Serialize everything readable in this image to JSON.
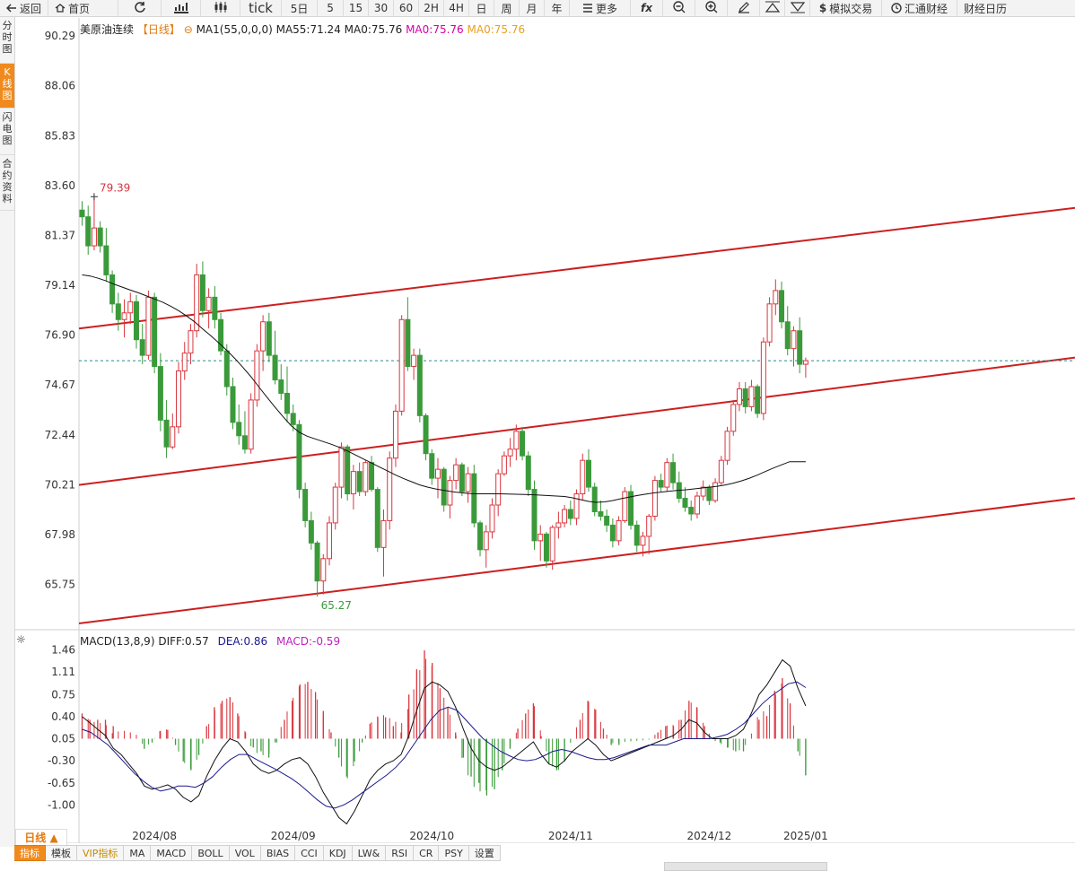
{
  "toolbar": {
    "back": "返回",
    "home": "首页",
    "refresh_icon": "refresh-icon",
    "draw_icon": "line-chart-icon",
    "candle_icon": "candle-icon",
    "tick": "tick",
    "five_day": "5日",
    "periods": [
      "5",
      "15",
      "30",
      "60",
      "2H",
      "4H",
      "日",
      "周",
      "月",
      "年"
    ],
    "more": "更多",
    "fx": "fx",
    "zoom_out_icon": "zoom-out-icon",
    "zoom_in_icon": "zoom-in-icon",
    "pen_icon": "pen-icon",
    "up_icon": "triangle-up-icon",
    "down_icon": "triangle-down-icon",
    "sim_trade": "模拟交易",
    "huitong": "汇通财经",
    "calendar": "财经日历"
  },
  "side_tabs": [
    "分时图",
    "K线图",
    "闪电图",
    "合约资料"
  ],
  "legend": {
    "name": "美原油连续",
    "period": "【日线】",
    "ma1": "MA1(55,0,0,0)",
    "ma55": "MA55:71.24",
    "ma0a": "MA0:75.76",
    "ma0b": "MA0:75.76",
    "ma0c": "MA0:75.76"
  },
  "macd_legend": {
    "name": "MACD(13,8,9)",
    "diff": "DIFF:0.57",
    "dea": "DEA:0.86",
    "macd": "MACD:-0.59"
  },
  "colors": {
    "up": "#d9363e",
    "down": "#3a9a3a",
    "ma": "#111111",
    "trend": "#cc1f1f",
    "dea": "#1a1a8c",
    "current": "#2a8a8a"
  },
  "chart_data": {
    "type": "candlestick",
    "title": "美原油连续",
    "current_price": 75.76,
    "high_label": "79.39",
    "low_label": "65.27",
    "y_ticks": [
      "90.29",
      "88.06",
      "85.83",
      "83.60",
      "81.37",
      "79.14",
      "76.90",
      "74.67",
      "72.44",
      "70.21",
      "67.98",
      "65.75"
    ],
    "y_range": [
      63.8,
      91.1
    ],
    "x_labels": [
      "2024/08",
      "2024/09",
      "2024/10",
      "2024/11",
      "2024/12",
      "2025/01"
    ],
    "ohlc": [
      [
        82.5,
        82.9,
        81.8,
        82.2
      ],
      [
        82.2,
        82.7,
        80.5,
        80.9
      ],
      [
        80.9,
        83.1,
        80.7,
        81.7
      ],
      [
        81.7,
        82.0,
        80.6,
        80.9
      ],
      [
        80.9,
        81.7,
        79.3,
        79.6
      ],
      [
        79.6,
        79.8,
        77.9,
        78.3
      ],
      [
        78.3,
        78.8,
        77.1,
        77.6
      ],
      [
        77.6,
        78.5,
        76.8,
        77.9
      ],
      [
        77.9,
        78.8,
        77.4,
        78.4
      ],
      [
        78.4,
        78.7,
        76.3,
        76.7
      ],
      [
        76.7,
        77.4,
        75.6,
        76.0
      ],
      [
        76.0,
        78.9,
        75.8,
        78.6
      ],
      [
        78.6,
        78.8,
        75.2,
        75.5
      ],
      [
        75.5,
        76.1,
        72.6,
        73.1
      ],
      [
        73.1,
        74.0,
        71.4,
        71.9
      ],
      [
        71.9,
        73.4,
        71.8,
        72.8
      ],
      [
        72.8,
        75.7,
        72.5,
        75.3
      ],
      [
        75.3,
        76.6,
        74.9,
        76.1
      ],
      [
        76.1,
        77.4,
        75.6,
        77.1
      ],
      [
        77.1,
        80.1,
        76.8,
        79.6
      ],
      [
        79.6,
        80.2,
        77.7,
        78.0
      ],
      [
        78.0,
        79.0,
        77.2,
        78.6
      ],
      [
        78.6,
        79.1,
        77.2,
        77.6
      ],
      [
        77.6,
        77.9,
        76.0,
        76.2
      ],
      [
        76.2,
        76.5,
        74.2,
        74.6
      ],
      [
        74.6,
        75.0,
        72.7,
        73.0
      ],
      [
        73.0,
        73.8,
        72.0,
        72.4
      ],
      [
        72.4,
        73.5,
        71.6,
        71.8
      ],
      [
        71.8,
        74.3,
        71.6,
        74.0
      ],
      [
        74.0,
        76.5,
        73.7,
        76.2
      ],
      [
        76.2,
        77.8,
        75.3,
        77.5
      ],
      [
        77.5,
        77.9,
        75.7,
        76.0
      ],
      [
        76.0,
        77.1,
        74.7,
        74.9
      ],
      [
        74.9,
        75.6,
        74.0,
        74.3
      ],
      [
        74.3,
        75.5,
        73.0,
        73.4
      ],
      [
        73.4,
        73.8,
        72.6,
        72.9
      ],
      [
        72.9,
        73.1,
        69.6,
        70.0
      ],
      [
        70.0,
        70.3,
        68.3,
        68.6
      ],
      [
        68.6,
        69.0,
        67.3,
        67.6
      ],
      [
        67.6,
        67.7,
        65.2,
        65.9
      ],
      [
        65.9,
        67.1,
        65.3,
        66.9
      ],
      [
        66.9,
        68.8,
        66.6,
        68.5
      ],
      [
        68.5,
        70.3,
        68.2,
        70.1
      ],
      [
        70.1,
        72.1,
        69.6,
        71.9
      ],
      [
        71.9,
        72.0,
        69.5,
        69.8
      ],
      [
        69.8,
        71.1,
        69.1,
        70.8
      ],
      [
        70.8,
        71.2,
        69.7,
        69.9
      ],
      [
        69.9,
        71.3,
        69.7,
        71.2
      ],
      [
        71.2,
        71.5,
        69.9,
        70.0
      ],
      [
        70.0,
        70.1,
        67.2,
        67.4
      ],
      [
        67.4,
        69.1,
        66.1,
        68.6
      ],
      [
        68.6,
        71.7,
        68.2,
        71.4
      ],
      [
        71.4,
        73.8,
        71.0,
        73.5
      ],
      [
        73.5,
        77.8,
        73.3,
        77.6
      ],
      [
        77.6,
        78.6,
        75.3,
        75.5
      ],
      [
        75.5,
        76.3,
        74.9,
        76.0
      ],
      [
        76.0,
        76.3,
        73.0,
        73.3
      ],
      [
        73.3,
        73.4,
        71.3,
        71.6
      ],
      [
        71.6,
        71.8,
        70.2,
        70.5
      ],
      [
        70.5,
        71.4,
        69.6,
        70.9
      ],
      [
        70.9,
        71.0,
        69.0,
        69.3
      ],
      [
        69.3,
        70.6,
        68.7,
        70.4
      ],
      [
        70.4,
        71.4,
        70.0,
        71.1
      ],
      [
        71.1,
        71.2,
        69.7,
        69.9
      ],
      [
        69.9,
        71.0,
        69.4,
        70.7
      ],
      [
        70.7,
        71.1,
        68.3,
        68.5
      ],
      [
        68.5,
        68.6,
        67.0,
        67.3
      ],
      [
        67.3,
        68.4,
        66.5,
        68.1
      ],
      [
        68.1,
        69.6,
        67.8,
        69.3
      ],
      [
        69.3,
        70.9,
        68.8,
        70.7
      ],
      [
        70.7,
        71.7,
        70.6,
        71.5
      ],
      [
        71.5,
        72.3,
        71.0,
        71.8
      ],
      [
        71.8,
        72.9,
        71.3,
        72.6
      ],
      [
        72.6,
        72.8,
        71.3,
        71.5
      ],
      [
        71.5,
        71.7,
        69.7,
        70.0
      ],
      [
        70.0,
        70.4,
        67.3,
        67.7
      ],
      [
        67.7,
        68.4,
        66.8,
        68.0
      ],
      [
        68.0,
        68.1,
        66.5,
        66.8
      ],
      [
        66.8,
        68.4,
        66.4,
        68.3
      ],
      [
        68.3,
        69.0,
        67.8,
        68.5
      ],
      [
        68.5,
        69.3,
        68.3,
        69.1
      ],
      [
        69.1,
        69.5,
        68.4,
        68.7
      ],
      [
        68.7,
        70.0,
        68.4,
        69.8
      ],
      [
        69.8,
        71.6,
        69.5,
        71.3
      ],
      [
        71.3,
        71.8,
        69.9,
        70.1
      ],
      [
        70.1,
        70.3,
        68.8,
        69.0
      ],
      [
        69.0,
        69.5,
        68.6,
        68.8
      ],
      [
        68.8,
        69.1,
        68.1,
        68.4
      ],
      [
        68.4,
        68.7,
        67.4,
        67.7
      ],
      [
        67.7,
        68.8,
        67.5,
        68.6
      ],
      [
        68.6,
        70.1,
        68.5,
        69.9
      ],
      [
        69.9,
        70.2,
        68.2,
        68.4
      ],
      [
        68.4,
        68.6,
        67.2,
        67.5
      ],
      [
        67.5,
        68.1,
        67.0,
        67.9
      ],
      [
        67.9,
        68.9,
        67.1,
        68.8
      ],
      [
        68.8,
        70.6,
        68.6,
        70.4
      ],
      [
        70.4,
        70.7,
        69.9,
        70.1
      ],
      [
        70.1,
        71.4,
        69.9,
        71.2
      ],
      [
        71.2,
        71.6,
        70.0,
        70.3
      ],
      [
        70.3,
        70.8,
        69.4,
        69.6
      ],
      [
        69.6,
        70.1,
        69.0,
        69.2
      ],
      [
        69.2,
        69.5,
        68.6,
        68.9
      ],
      [
        68.9,
        69.9,
        68.7,
        69.7
      ],
      [
        69.7,
        70.4,
        69.5,
        70.1
      ],
      [
        70.1,
        70.2,
        69.3,
        69.5
      ],
      [
        69.5,
        70.5,
        69.4,
        70.3
      ],
      [
        70.3,
        71.5,
        70.2,
        71.3
      ],
      [
        71.3,
        72.8,
        71.1,
        72.6
      ],
      [
        72.6,
        74.0,
        72.4,
        73.8
      ],
      [
        73.8,
        74.8,
        73.5,
        74.5
      ],
      [
        74.5,
        74.8,
        73.4,
        73.7
      ],
      [
        73.7,
        74.9,
        73.5,
        74.6
      ],
      [
        74.6,
        74.7,
        73.2,
        73.4
      ],
      [
        73.4,
        76.8,
        73.1,
        76.6
      ],
      [
        76.6,
        78.6,
        76.4,
        78.3
      ],
      [
        78.3,
        79.4,
        77.8,
        78.9
      ],
      [
        78.9,
        79.3,
        77.2,
        77.5
      ],
      [
        77.5,
        78.2,
        76.0,
        76.3
      ],
      [
        76.3,
        77.3,
        75.5,
        77.1
      ],
      [
        77.1,
        77.7,
        75.2,
        75.6
      ],
      [
        75.6,
        75.9,
        75.0,
        75.76
      ]
    ],
    "ma55_series": [
      79.6,
      79.55,
      79.45,
      79.33,
      79.18,
      79.05,
      78.92,
      78.8,
      78.66,
      78.52,
      78.38,
      78.2,
      78.0,
      77.76,
      77.5,
      77.18,
      76.88,
      76.56,
      76.22,
      75.86,
      75.46,
      75.04,
      74.58,
      74.12,
      73.68,
      73.25,
      72.85,
      72.56,
      72.38,
      72.26,
      72.14,
      72.02,
      71.88,
      71.72,
      71.54,
      71.36,
      71.18,
      71.0,
      70.82,
      70.64,
      70.48,
      70.34,
      70.2,
      70.1,
      70.02,
      69.96,
      69.9,
      69.86,
      69.82,
      69.8,
      69.8,
      69.8,
      69.8,
      69.79,
      69.78,
      69.77,
      69.76,
      69.74,
      69.72,
      69.7,
      69.68,
      69.62,
      69.54,
      69.46,
      69.42,
      69.44,
      69.5,
      69.58,
      69.65,
      69.72,
      69.78,
      69.84,
      69.88,
      69.92,
      69.95,
      69.98,
      70.02,
      70.06,
      70.1,
      70.14,
      70.2,
      70.28,
      70.38,
      70.5,
      70.64,
      70.8,
      70.96,
      71.1,
      71.24,
      71.24,
      71.24
    ],
    "trend_lines": [
      {
        "x": [
          "2024/07/16",
          "2025/01/31"
        ],
        "y": [
          77.2,
          82.6
        ]
      },
      {
        "x": [
          "2024/07/16",
          "2025/01/31"
        ],
        "y": [
          70.2,
          75.9
        ]
      },
      {
        "x": [
          "2024/07/16",
          "2025/01/31"
        ],
        "y": [
          64.0,
          69.6
        ]
      }
    ],
    "macd": {
      "y_ticks": [
        "1.46",
        "1.11",
        "0.75",
        "0.40",
        "0.05",
        "-0.30",
        "-0.65",
        "-1.00"
      ],
      "y_range": [
        -1.35,
        1.55
      ],
      "diff": [
        0.4,
        0.3,
        0.2,
        0.1,
        -0.1,
        -0.2,
        -0.35,
        -0.5,
        -0.7,
        -0.75,
        -0.72,
        -0.68,
        -0.75,
        -0.88,
        -0.95,
        -0.85,
        -0.55,
        -0.3,
        -0.1,
        0.05,
        0.0,
        -0.15,
        -0.35,
        -0.45,
        -0.5,
        -0.45,
        -0.35,
        -0.28,
        -0.25,
        -0.35,
        -0.55,
        -0.8,
        -1.0,
        -1.2,
        -1.3,
        -1.1,
        -0.85,
        -0.6,
        -0.45,
        -0.35,
        -0.3,
        -0.2,
        0.1,
        0.5,
        0.85,
        0.95,
        0.9,
        0.8,
        0.55,
        0.2,
        -0.1,
        -0.3,
        -0.4,
        -0.45,
        -0.4,
        -0.3,
        -0.2,
        -0.1,
        0.0,
        -0.2,
        -0.35,
        -0.4,
        -0.3,
        -0.15,
        -0.05,
        0.05,
        -0.05,
        -0.2,
        -0.3,
        -0.25,
        -0.2,
        -0.15,
        -0.1,
        -0.05,
        0.0,
        0.05,
        0.1,
        0.2,
        0.35,
        0.3,
        0.15,
        0.05,
        0.05,
        0.05,
        0.1,
        0.2,
        0.45,
        0.75,
        0.9,
        1.1,
        1.3,
        1.2,
        0.85,
        0.57
      ],
      "dea": [
        0.2,
        0.15,
        0.05,
        -0.05,
        -0.2,
        -0.35,
        -0.5,
        -0.62,
        -0.72,
        -0.78,
        -0.75,
        -0.7,
        -0.7,
        -0.72,
        -0.65,
        -0.55,
        -0.4,
        -0.28,
        -0.2,
        -0.2,
        -0.28,
        -0.35,
        -0.42,
        -0.5,
        -0.58,
        -0.68,
        -0.8,
        -0.92,
        -1.02,
        -1.05,
        -1.0,
        -0.92,
        -0.82,
        -0.72,
        -0.62,
        -0.52,
        -0.4,
        -0.25,
        -0.05,
        0.15,
        0.35,
        0.5,
        0.55,
        0.5,
        0.35,
        0.2,
        0.05,
        -0.05,
        -0.15,
        -0.22,
        -0.28,
        -0.3,
        -0.28,
        -0.22,
        -0.15,
        -0.12,
        -0.15,
        -0.2,
        -0.25,
        -0.28,
        -0.28,
        -0.25,
        -0.2,
        -0.15,
        -0.1,
        -0.05,
        -0.05,
        -0.05,
        0.0,
        0.05,
        0.05,
        0.05,
        0.05,
        0.08,
        0.12,
        0.2,
        0.3,
        0.45,
        0.6,
        0.72,
        0.82,
        0.92,
        0.95,
        0.86
      ]
    }
  },
  "bottom": {
    "period": "日线 ▲",
    "tabs": [
      "指标",
      "模板",
      "VIP指标",
      "MA",
      "MACD",
      "BOLL",
      "VOL",
      "BIAS",
      "CCI",
      "KDJ",
      "LW&",
      "RSI",
      "CR",
      "PSY",
      "设置"
    ]
  }
}
